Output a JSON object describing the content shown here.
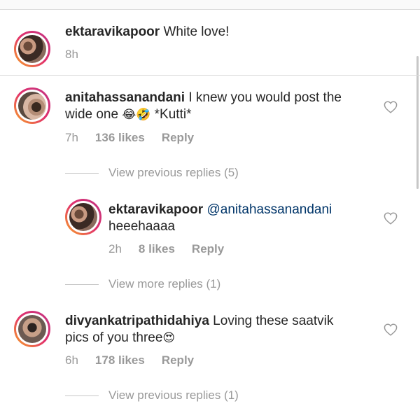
{
  "comments": [
    {
      "username": "ektaravikapoor",
      "text": " White love!",
      "time": "8h"
    },
    {
      "username": "anitahassanandani",
      "text_line1": " I knew you would post the",
      "text_line2": "wide one ",
      "emojis": "😂🤣",
      "text_after": " *Kutti*",
      "time": "7h",
      "likes": "136 likes",
      "reply": "Reply",
      "view_replies": "View previous replies (5)"
    },
    {
      "username": "ektaravikapoor",
      "mention": "@anitahassanandani",
      "text_line2": "heeehaaaa",
      "time": "2h",
      "likes": "8 likes",
      "reply": "Reply",
      "view_replies": "View more replies (1)"
    },
    {
      "username": "divyankatripathidahiya",
      "text_line1": " Loving these saatvik",
      "text_line2": "pics of you three",
      "emojis": "😍",
      "time": "6h",
      "likes": "178 likes",
      "reply": "Reply",
      "view_replies": "View previous replies (1)"
    }
  ],
  "icons": {
    "heart": "heart-outline-icon",
    "avatar_ring_colors": [
      "#f9a825",
      "#e1306c",
      "#c13584"
    ]
  }
}
